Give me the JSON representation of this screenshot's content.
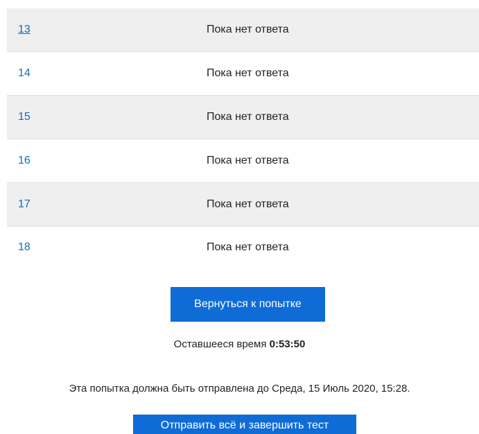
{
  "questions": [
    {
      "number": "13",
      "status": "Пока нет ответа"
    },
    {
      "number": "14",
      "status": "Пока нет ответа"
    },
    {
      "number": "15",
      "status": "Пока нет ответа"
    },
    {
      "number": "16",
      "status": "Пока нет ответа"
    },
    {
      "number": "17",
      "status": "Пока нет ответа"
    },
    {
      "number": "18",
      "status": "Пока нет ответа"
    }
  ],
  "return_button_label": "Вернуться к попытке",
  "timer": {
    "label": "Оставшееся время",
    "value": "0:53:50"
  },
  "deadline_text": "Эта попытка должна быть отправлена до Среда, 15 Июль 2020, 15:28.",
  "submit_button_label": "Отправить всё и завершить тест",
  "colors": {
    "link": "#0f6cbf",
    "button": "#0f6cd7",
    "row_alt": "#efefef"
  }
}
